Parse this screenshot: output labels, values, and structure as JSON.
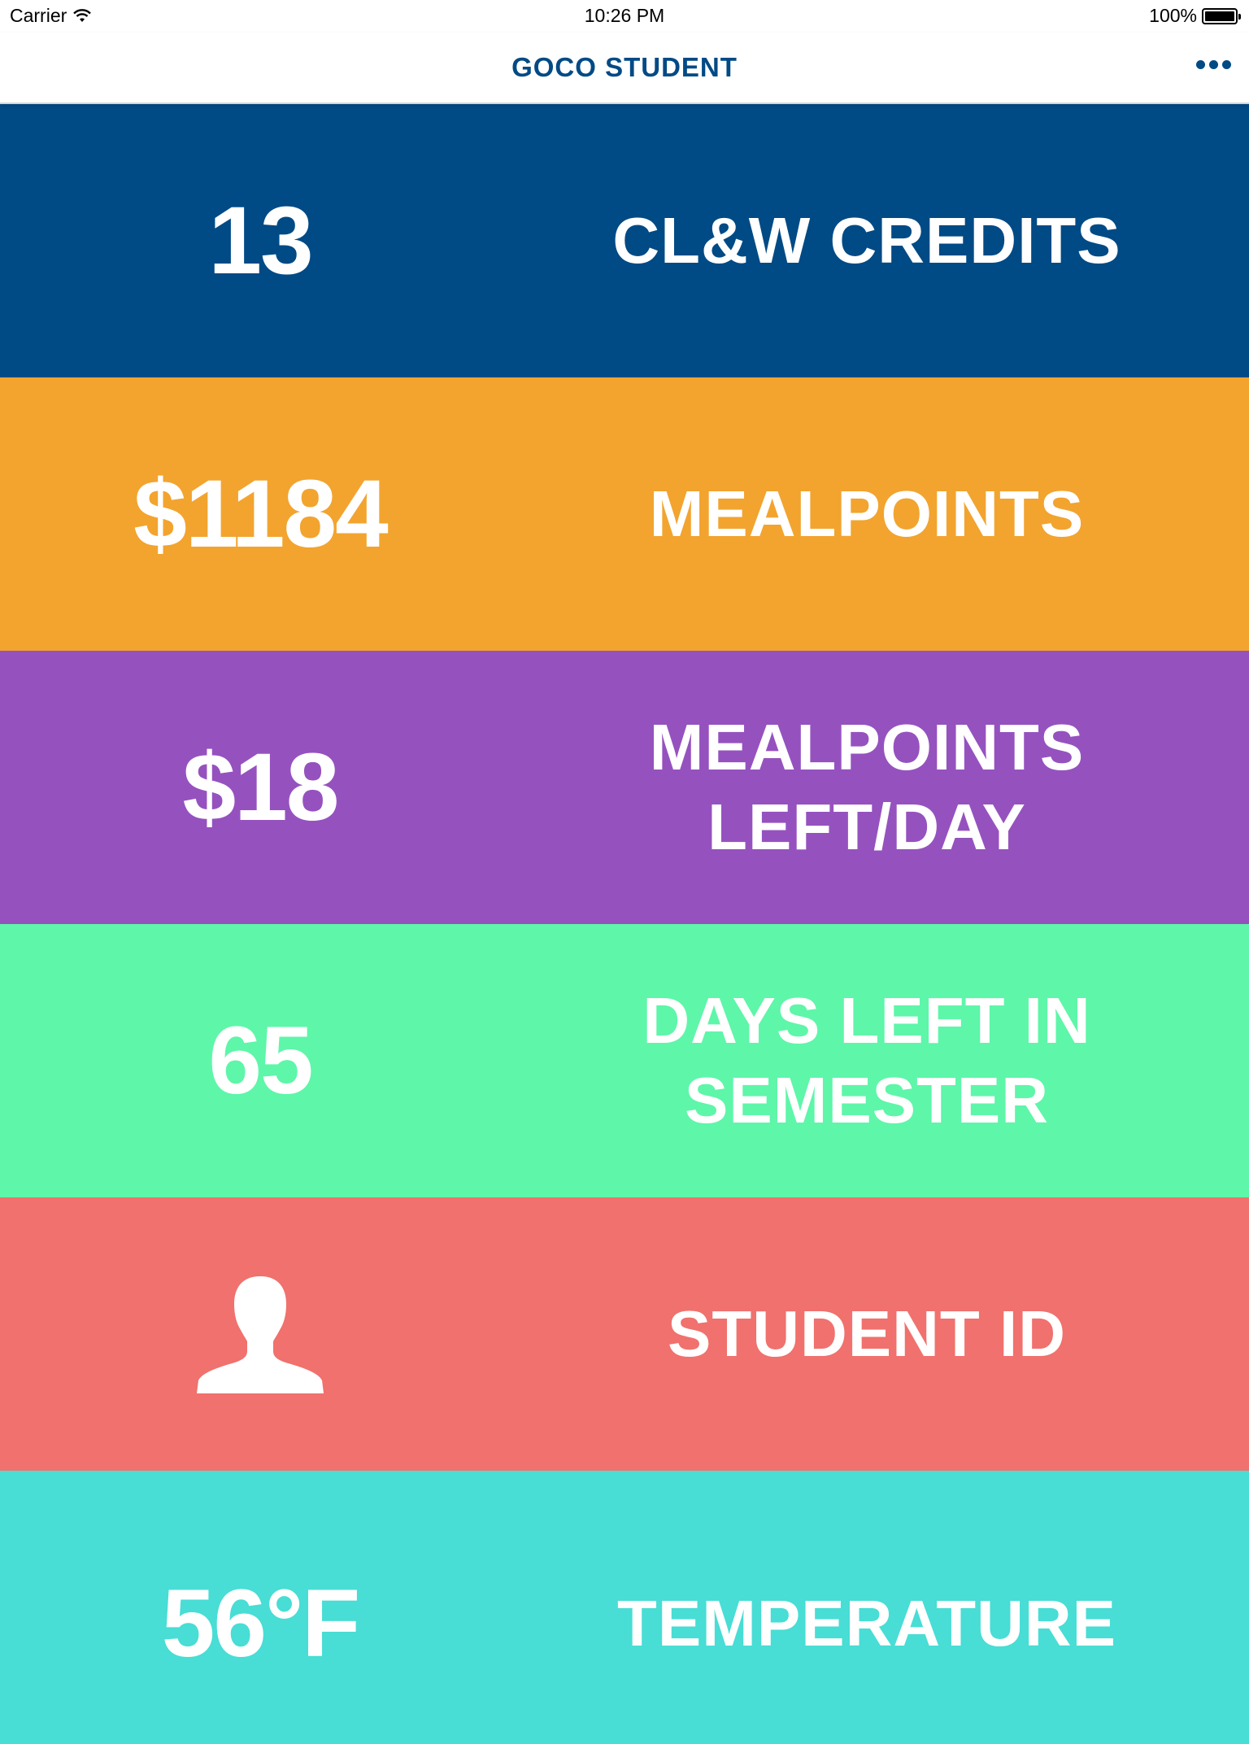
{
  "status_bar": {
    "carrier": "Carrier",
    "time": "10:26 PM",
    "battery": "100%"
  },
  "nav": {
    "title": "GOCO STUDENT",
    "more_icon": "more-horizontal-icon"
  },
  "tiles": [
    {
      "value": "13",
      "label": "CL&W CREDITS",
      "color": "#004a85"
    },
    {
      "value": "$1184",
      "label": "MEALPOINTS",
      "color": "#f2a42f"
    },
    {
      "value": "$18",
      "label": "MEALPOINTS LEFT/DAY",
      "color": "#9552bf"
    },
    {
      "value": "65",
      "label": "DAYS LEFT IN SEMESTER",
      "color": "#5ef6a9"
    },
    {
      "icon": "person-icon",
      "label": "STUDENT ID",
      "color": "#f0716d"
    },
    {
      "value": "56°F",
      "label": "TEMPERATURE",
      "color": "#48ddd5"
    }
  ]
}
